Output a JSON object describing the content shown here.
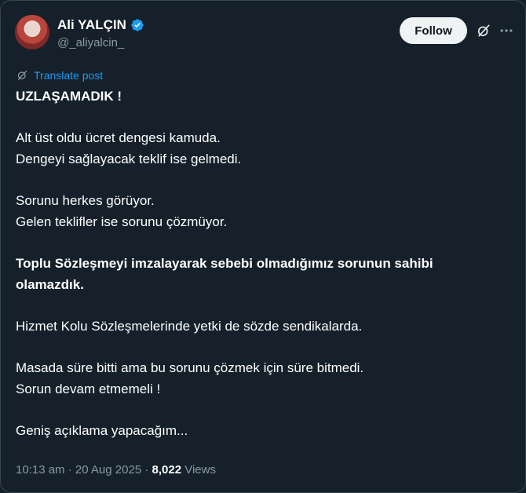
{
  "author": {
    "display_name": "Ali YALÇIN",
    "handle": "@_aliyalcin_",
    "avatar_icon": "profile-photo",
    "verified_icon": "verified-badge-icon",
    "verified_color": "#1d9bf0"
  },
  "actions": {
    "follow_label": "Follow",
    "grok_icon": "grok-icon",
    "more_icon": "more-options-icon"
  },
  "translate": {
    "icon": "translate-icon",
    "label": "Translate post"
  },
  "post": {
    "paragraphs": [
      {
        "lines": [
          "UZLAŞAMADIK !"
        ],
        "bold": true
      },
      {
        "lines": [
          "Alt üst oldu ücret dengesi kamuda.",
          "Dengeyi sağlayacak teklif ise gelmedi."
        ],
        "bold": false
      },
      {
        "lines": [
          "Sorunu herkes görüyor.",
          "Gelen teklifler ise sorunu çözmüyor."
        ],
        "bold": false
      },
      {
        "lines": [
          "Toplu Sözleşmeyi imzalayarak sebebi olmadığımız sorunun sahibi",
          "olamazdık."
        ],
        "bold": true
      },
      {
        "lines": [
          "Hizmet Kolu Sözleşmelerinde yetki de sözde sendikalarda."
        ],
        "bold": false
      },
      {
        "lines": [
          "Masada süre bitti ama bu sorunu çözmek için süre bitmedi.",
          "Sorun devam etmemeli !"
        ],
        "bold": false
      },
      {
        "lines": [
          "Geniş açıklama yapacağım..."
        ],
        "bold": false
      }
    ]
  },
  "meta": {
    "time": "10:13 am",
    "separator": "·",
    "date": "20 Aug 2025",
    "views_count": "8,022",
    "views_label": "Views"
  },
  "colors": {
    "background": "#15202b",
    "text": "#ffffff",
    "secondary": "#8b98a5",
    "link": "#1d9bf0",
    "follow_bg": "#eff3f4"
  }
}
